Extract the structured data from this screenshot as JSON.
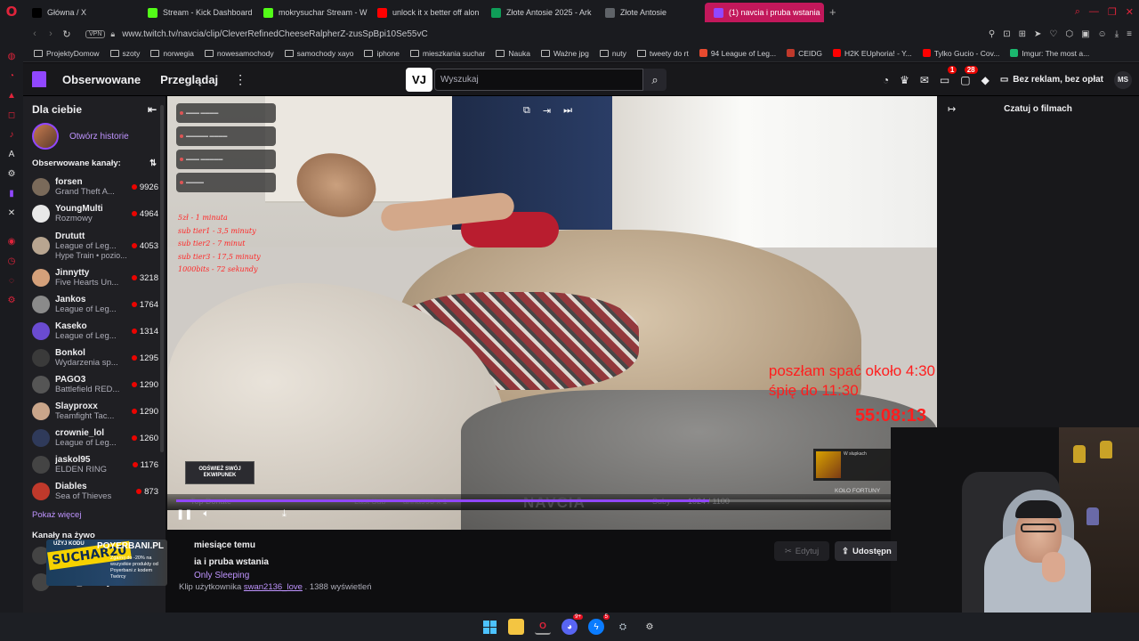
{
  "browser": {
    "tabs": [
      {
        "label": "Główna / X",
        "icon": "x-icon",
        "color": "#000000"
      },
      {
        "label": "Stream - Kick Dashboard",
        "icon": "kick-icon",
        "color": "#53fc18"
      },
      {
        "label": "mokrysuchar Stream - W",
        "icon": "kick-icon",
        "color": "#53fc18"
      },
      {
        "label": "unlock it x better off alon",
        "icon": "youtube-icon",
        "color": "#ff0000"
      },
      {
        "label": "Złote Antosie 2025 - Ark",
        "icon": "sheets-icon",
        "color": "#0f9d58"
      },
      {
        "label": "Złote Antosie",
        "icon": "doc-icon",
        "color": "#5f6368"
      },
      {
        "label": "(1) navcia i pruba wstania",
        "icon": "twitch-icon",
        "color": "#9147ff",
        "active": true
      }
    ],
    "new_tab": "+",
    "vpn": "VPN",
    "url": "www.twitch.tv/navcia/clip/CleverRefinedCheeseRalpherZ-zusSpBpi10Se55vC",
    "bookmarks": [
      {
        "label": "ProjektyDomow",
        "type": "folder"
      },
      {
        "label": "szoty",
        "type": "folder"
      },
      {
        "label": "norwegia",
        "type": "folder"
      },
      {
        "label": "nowesamochody",
        "type": "folder"
      },
      {
        "label": "samochody xayo",
        "type": "folder"
      },
      {
        "label": "iphone",
        "type": "folder"
      },
      {
        "label": "mieszkania suchar",
        "type": "folder"
      },
      {
        "label": "Nauka",
        "type": "folder"
      },
      {
        "label": "Ważne jpg",
        "type": "folder"
      },
      {
        "label": "nuty",
        "type": "folder"
      },
      {
        "label": "tweety do rt",
        "type": "folder"
      },
      {
        "label": "94 League of Leg...",
        "type": "site",
        "color": "#e84a2f"
      },
      {
        "label": "CEIDG",
        "type": "site",
        "color": "#c0392b"
      },
      {
        "label": "H2K EUphoria! - Y...",
        "type": "site",
        "color": "#ff0000"
      },
      {
        "label": "Tylko Gucio - Cov...",
        "type": "site",
        "color": "#ff0000"
      },
      {
        "label": "Imgur: The most a...",
        "type": "site",
        "color": "#1bb76e"
      }
    ]
  },
  "twitch_nav": {
    "following": "Obserwowane",
    "browse": "Przeglądaj",
    "extension_label": "VJ",
    "search_placeholder": "Wyszukaj",
    "inbox_badge": "1",
    "notif_badge": "28",
    "no_ads": "Bez reklam, bez opłat",
    "user_initials": "MS"
  },
  "sidebar": {
    "title": "Dla ciebie",
    "story_label": "Otwórz historie",
    "followed_title": "Obserwowane kanały:",
    "channels": [
      {
        "name": "forsen",
        "game": "Grand Theft A...",
        "viewers": "9926",
        "color": "#7a6a5a"
      },
      {
        "name": "YoungMulti",
        "game": "Rozmowy",
        "viewers": "4964",
        "color": "#e8e8e8"
      },
      {
        "name": "Drututt",
        "game": "League of Leg...",
        "extra": "Hype Train • pozio...",
        "viewers": "4053",
        "color": "#b8a590"
      },
      {
        "name": "Jinnytty",
        "game": "Five Hearts Un...",
        "viewers": "3218",
        "color": "#d4a07a"
      },
      {
        "name": "Jankos",
        "game": "League of Leg...",
        "viewers": "1764",
        "color": "#8a8a8a"
      },
      {
        "name": "Kaseko",
        "game": "League of Leg...",
        "viewers": "1314",
        "color": "#6a4bd1"
      },
      {
        "name": "Bonkol",
        "game": "Wydarzenia sp...",
        "viewers": "1295",
        "color": "#3a3a3a"
      },
      {
        "name": "PAGO3",
        "game": "Battlefield RED...",
        "viewers": "1290",
        "color": "#555555"
      },
      {
        "name": "Slayproxx",
        "game": "Teamfight Tac...",
        "viewers": "1290",
        "color": "#c9a58a"
      },
      {
        "name": "crownie_lol",
        "game": "League of Leg...",
        "viewers": "1260",
        "color": "#2f3a5a"
      },
      {
        "name": "jaskol95",
        "game": "ELDEN RING",
        "viewers": "1176",
        "color": "#444444"
      },
      {
        "name": "Diables",
        "game": "Sea of Thieves",
        "viewers": "873",
        "color": "#c0392b"
      }
    ],
    "show_more": "Pokaż więcej",
    "live_title": "Kanały na żywo",
    "live_channels": [
      {
        "name": "",
        "game": "IRL",
        "viewers": ""
      },
      {
        "name": "ostre_szachy",
        "game": "",
        "viewers": "9"
      }
    ]
  },
  "promo": {
    "top": "UŻYJ KODU",
    "code": "SUCHAR20",
    "brand": "POYERBANI.PL",
    "sub": "Zgarnij do -20% na wszystkie produkty od Poyerbani z kodem Twórcy"
  },
  "player": {
    "rules": [
      "5zł - 1 minuta",
      "sub tier1 - 3,5 minuty",
      "sub tier2 - 7 minut",
      "sub tier3 - 17,5 minuty",
      "1000bits - 72 sekundy"
    ],
    "caption_line1": "poszłam spać około 4:30",
    "caption_line2": "śpię do 11:30",
    "timer": "55:08:13",
    "button_overlay": "ODŚWIEŻ SWÓJ EKWIPUNEK",
    "wheel_label": "KOŁO FORTUNY",
    "wheel_title": "W słupkach",
    "bar_top_donate": "Top Donate",
    "bar_last_sub": "Last Sub",
    "bar_last_sub_value": "anna993 x 1",
    "bar_brand": "NAVCIA",
    "bar_subs": "Suby",
    "bar_subs_value": "1024 / 1100",
    "progress_fraction": 0.73
  },
  "chat_panel": {
    "title": "Czatuj o filmach"
  },
  "clip": {
    "time": "miesiące temu",
    "title": "ia i pruba wstania",
    "category": "Only Sleeping",
    "by_prefix": "Klip użytkownika",
    "user": "swan2136_love",
    "views": ". 1388 wyświetleń",
    "edit": "Edytuj",
    "share": "Udostępn"
  },
  "taskbar": {
    "discord_badge": "9+",
    "messenger_badge": "5"
  }
}
